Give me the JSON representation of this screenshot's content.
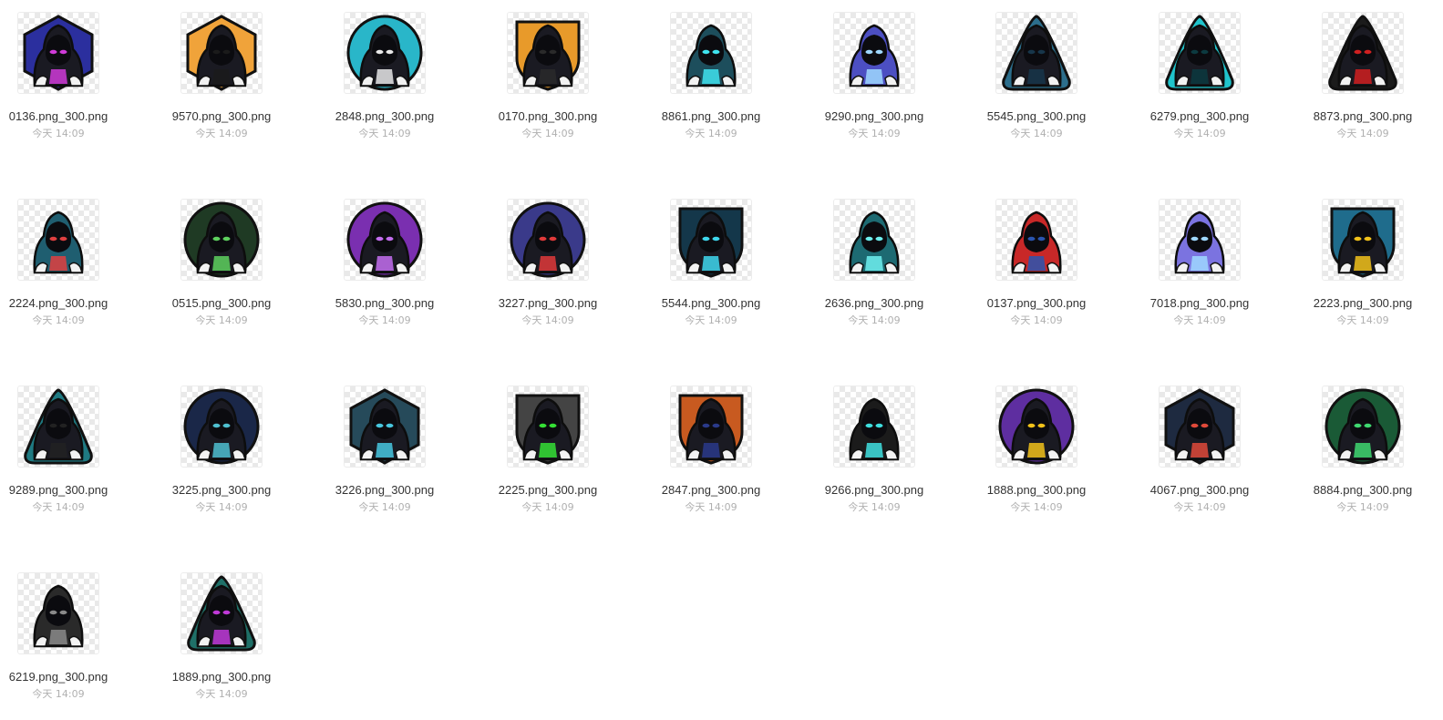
{
  "files": [
    {
      "name": "0136.png_300.png",
      "date": "今天 14:09",
      "icon": "hooded-hacker-mascot-icon",
      "badge": "hexagon",
      "accent": "#2b2f9e",
      "accent2": "#d03bd8"
    },
    {
      "name": "9570.png_300.png",
      "date": "今天 14:09",
      "icon": "hooded-hacker-mascot-icon",
      "badge": "hexagon",
      "accent": "#f0a33a",
      "accent2": "#1b1b1b"
    },
    {
      "name": "2848.png_300.png",
      "date": "今天 14:09",
      "icon": "hooded-hacker-mascot-icon",
      "badge": "circle",
      "accent": "#29b6c9",
      "accent2": "#e8e8e8"
    },
    {
      "name": "0170.png_300.png",
      "date": "今天 14:09",
      "icon": "hooded-hacker-mascot-icon",
      "badge": "shield",
      "accent": "#e89a2a",
      "accent2": "#2a2a2a"
    },
    {
      "name": "8861.png_300.png",
      "date": "今天 14:09",
      "icon": "hooded-hacker-mascot-icon",
      "badge": "none",
      "accent": "#1d4e5c",
      "accent2": "#3fe3ee"
    },
    {
      "name": "9290.png_300.png",
      "date": "今天 14:09",
      "icon": "hooded-hacker-mascot-icon",
      "badge": "none",
      "accent": "#4c4fc2",
      "accent2": "#9fd8ff"
    },
    {
      "name": "5545.png_300.png",
      "date": "今天 14:09",
      "icon": "hooded-hacker-mascot-icon",
      "badge": "triangle",
      "accent": "#2c6e8c",
      "accent2": "#17364a"
    },
    {
      "name": "6279.png_300.png",
      "date": "今天 14:09",
      "icon": "hooded-hacker-mascot-icon",
      "badge": "triangle",
      "accent": "#20c4cc",
      "accent2": "#0c3a40"
    },
    {
      "name": "8873.png_300.png",
      "date": "今天 14:09",
      "icon": "hooded-hacker-mascot-icon",
      "badge": "triangle",
      "accent": "#1b1b1b",
      "accent2": "#d02020"
    },
    {
      "name": "2224.png_300.png",
      "date": "今天 14:09",
      "icon": "hooded-hacker-mascot-icon",
      "badge": "none",
      "accent": "#1f5e70",
      "accent2": "#e04040"
    },
    {
      "name": "0515.png_300.png",
      "date": "今天 14:09",
      "icon": "hooded-hacker-mascot-icon",
      "badge": "circle",
      "accent": "#1f3a24",
      "accent2": "#5ed15e"
    },
    {
      "name": "5830.png_300.png",
      "date": "今天 14:09",
      "icon": "hooded-hacker-mascot-icon",
      "badge": "circle",
      "accent": "#7a2fb0",
      "accent2": "#c46ef0"
    },
    {
      "name": "3227.png_300.png",
      "date": "今天 14:09",
      "icon": "hooded-hacker-mascot-icon",
      "badge": "circle",
      "accent": "#3a3a8a",
      "accent2": "#e03a3a"
    },
    {
      "name": "5544.png_300.png",
      "date": "今天 14:09",
      "icon": "hooded-hacker-mascot-icon",
      "badge": "shield",
      "accent": "#14374a",
      "accent2": "#3fd8ee"
    },
    {
      "name": "2636.png_300.png",
      "date": "今天 14:09",
      "icon": "hooded-hacker-mascot-icon",
      "badge": "none",
      "accent": "#1d6a72",
      "accent2": "#6ff0f0"
    },
    {
      "name": "0137.png_300.png",
      "date": "今天 14:09",
      "icon": "hooded-hacker-mascot-icon",
      "badge": "none",
      "accent": "#c82828",
      "accent2": "#2a55b0"
    },
    {
      "name": "7018.png_300.png",
      "date": "今天 14:09",
      "icon": "hooded-hacker-mascot-icon",
      "badge": "none",
      "accent": "#7b73e0",
      "accent2": "#9fd8ff"
    },
    {
      "name": "2223.png_300.png",
      "date": "今天 14:09",
      "icon": "hooded-hacker-mascot-icon",
      "badge": "shield",
      "accent": "#1f6c8c",
      "accent2": "#f2c21a"
    },
    {
      "name": "9289.png_300.png",
      "date": "今天 14:09",
      "icon": "hooded-hacker-mascot-icon",
      "badge": "triangle",
      "accent": "#1f7a82",
      "accent2": "#222222"
    },
    {
      "name": "3225.png_300.png",
      "date": "今天 14:09",
      "icon": "hooded-hacker-mascot-icon",
      "badge": "circle",
      "accent": "#1a2748",
      "accent2": "#4fc0d0"
    },
    {
      "name": "3226.png_300.png",
      "date": "今天 14:09",
      "icon": "hooded-hacker-mascot-icon",
      "badge": "hexagon",
      "accent": "#264a5a",
      "accent2": "#48c8e0"
    },
    {
      "name": "2225.png_300.png",
      "date": "今天 14:09",
      "icon": "hooded-hacker-mascot-icon",
      "badge": "shield",
      "accent": "#444444",
      "accent2": "#35e035"
    },
    {
      "name": "2847.png_300.png",
      "date": "今天 14:09",
      "icon": "hooded-hacker-mascot-icon",
      "badge": "shield",
      "accent": "#c85a20",
      "accent2": "#2a3a8a"
    },
    {
      "name": "9266.png_300.png",
      "date": "今天 14:09",
      "icon": "hooded-hacker-mascot-icon",
      "badge": "none",
      "accent": "#1b1b1b",
      "accent2": "#3fe0e0"
    },
    {
      "name": "1888.png_300.png",
      "date": "今天 14:09",
      "icon": "hooded-hacker-mascot-icon",
      "badge": "circle",
      "accent": "#5e2ea0",
      "accent2": "#f2c21a"
    },
    {
      "name": "4067.png_300.png",
      "date": "今天 14:09",
      "icon": "hooded-hacker-mascot-icon",
      "badge": "hexagon",
      "accent": "#1e2a40",
      "accent2": "#e04a3a"
    },
    {
      "name": "8884.png_300.png",
      "date": "今天 14:09",
      "icon": "hooded-hacker-mascot-icon",
      "badge": "circle",
      "accent": "#1a5a36",
      "accent2": "#3fd870"
    },
    {
      "name": "6219.png_300.png",
      "date": "今天 14:09",
      "icon": "hooded-hacker-mascot-icon",
      "badge": "none",
      "accent": "#2a2a2a",
      "accent2": "#8a8a8a"
    },
    {
      "name": "1889.png_300.png",
      "date": "今天 14:09",
      "icon": "hooded-hacker-mascot-icon",
      "badge": "triangle",
      "accent": "#1f7068",
      "accent2": "#c03ad8"
    }
  ]
}
